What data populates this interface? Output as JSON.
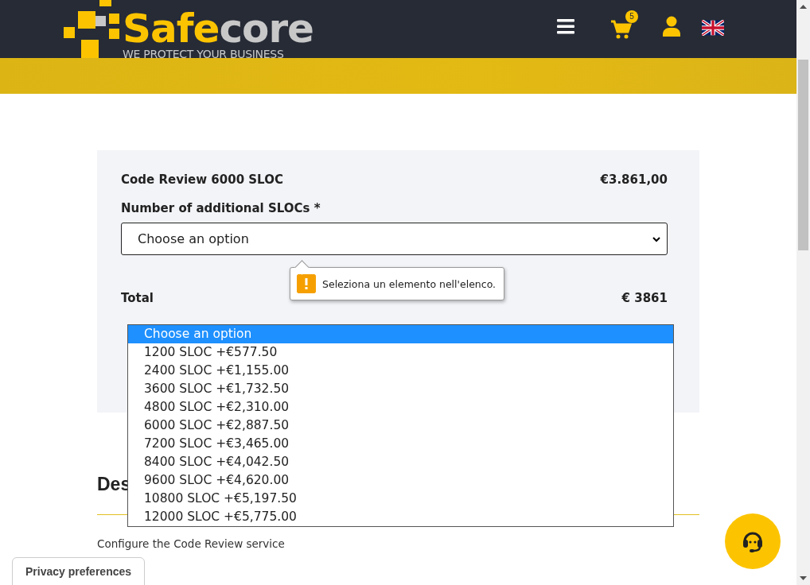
{
  "header": {
    "logo": {
      "brand_part_1": "Safe",
      "brand_part_2": "core",
      "tagline": "WE PROTECT YOUR BUSINESS"
    },
    "cart_count": "5"
  },
  "product": {
    "name": "Code Review 6000 SLOC",
    "price": "€3.861,00",
    "field_label": "Number of additional SLOCs *",
    "select_value": "Choose an option",
    "validation_message": "Seleziona un elemento nell'elenco.",
    "total_label": "Total",
    "total_value": "€ 3861"
  },
  "dropdown": {
    "options": [
      {
        "label": "Choose an option",
        "selected": true
      },
      {
        "label": "1200 SLOC +€577.50",
        "selected": false
      },
      {
        "label": "2400 SLOC +€1,155.00",
        "selected": false
      },
      {
        "label": "3600 SLOC +€1,732.50",
        "selected": false
      },
      {
        "label": "4800 SLOC +€2,310.00",
        "selected": false
      },
      {
        "label": "6000 SLOC +€2,887.50",
        "selected": false
      },
      {
        "label": "7200 SLOC +€3,465.00",
        "selected": false
      },
      {
        "label": "8400 SLOC +€4,042.50",
        "selected": false
      },
      {
        "label": "9600 SLOC +€4,620.00",
        "selected": false
      },
      {
        "label": "10800 SLOC +€5,197.50",
        "selected": false
      },
      {
        "label": "12000 SLOC +€5,775.00",
        "selected": false
      }
    ]
  },
  "description": {
    "heading": "Des",
    "text": "Configure the Code Review service"
  },
  "privacy_button": "Privacy preferences"
}
